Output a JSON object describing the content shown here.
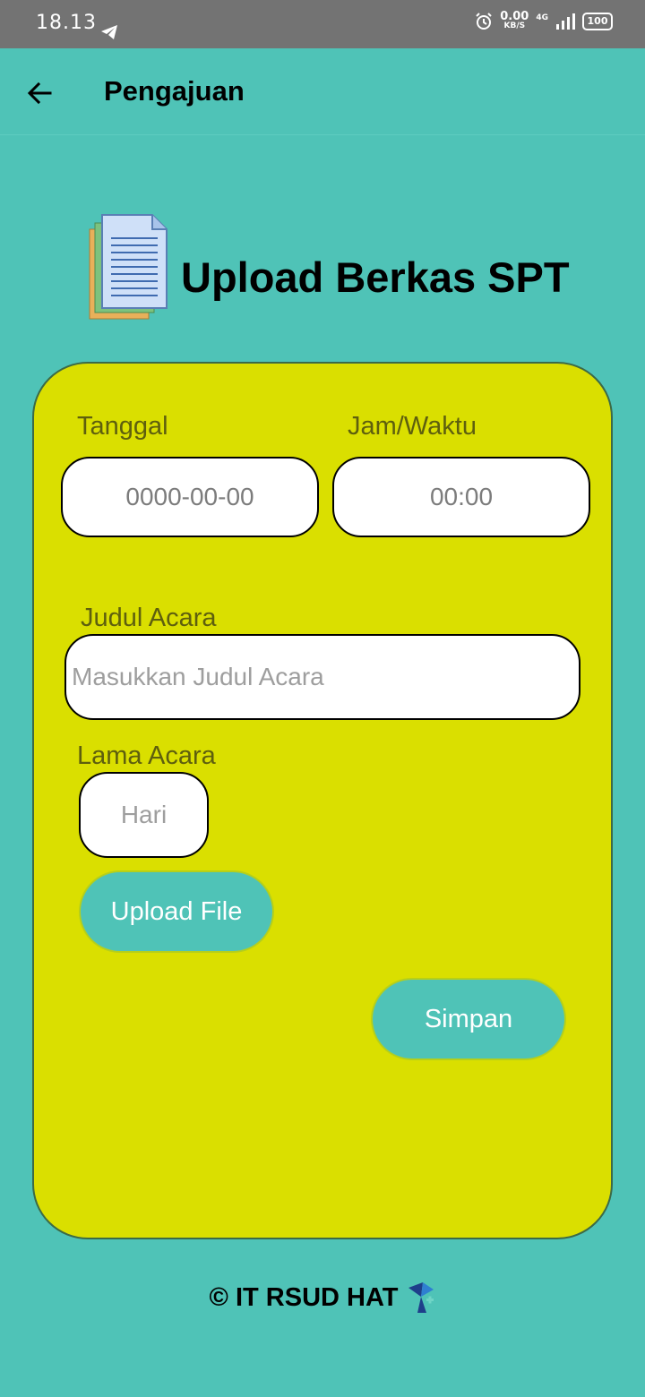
{
  "status_bar": {
    "time": "18.13",
    "speed_value": "0.00",
    "speed_unit": "KB/S",
    "network": "4G",
    "battery": "100"
  },
  "app_bar": {
    "title": "Pengajuan"
  },
  "page": {
    "heading": "Upload Berkas SPT"
  },
  "form": {
    "date_label": "Tanggal",
    "date_value": "0000-00-00",
    "time_label": "Jam/Waktu",
    "time_value": "00:00",
    "event_title_label": "Judul Acara",
    "event_title_placeholder": "Masukkan Judul Acara",
    "duration_label": "Lama Acara",
    "duration_placeholder": "Hari",
    "upload_button": "Upload File",
    "save_button": "Simpan"
  },
  "footer": {
    "text": "© IT RSUD HAT"
  },
  "colors": {
    "background": "#4fc3b7",
    "status_bar": "#737373",
    "card": "#dadf00",
    "label_text": "#5e5f0e",
    "button": "#4fc3b7"
  },
  "icons": {
    "back": "arrow-left-icon",
    "document": "document-stack-icon",
    "footer_logo": "hospital-logo-icon"
  }
}
